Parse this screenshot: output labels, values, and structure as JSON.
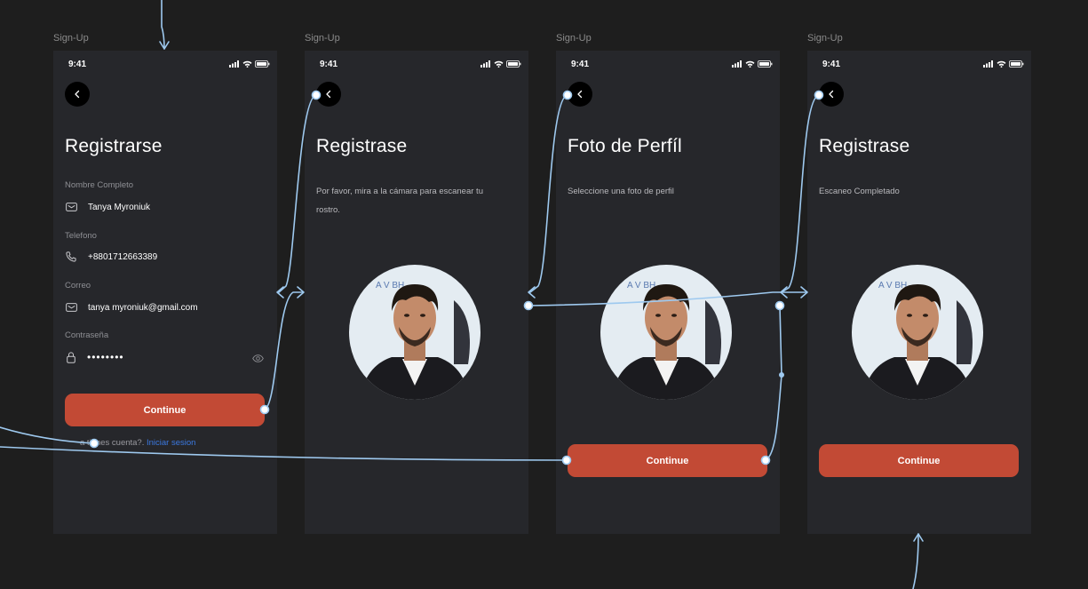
{
  "frames": [
    {
      "label": "Sign-Up",
      "time": "9:41",
      "title": "Registrarse",
      "fields": [
        {
          "label": "Nombre Completo",
          "value": "Tanya Myroniuk",
          "icon": "mail-icon"
        },
        {
          "label": "Telefono",
          "value": "+8801712663389",
          "icon": "phone-icon"
        },
        {
          "label": "Correo",
          "value": "tanya myroniuk@gmail.com",
          "icon": "mail-icon"
        },
        {
          "label": "Contraseña",
          "value": "••••••••",
          "icon": "lock-icon"
        }
      ],
      "button": "Continue",
      "login_prefix": "a tienes cuenta?.",
      "login_link": "Iniciar sesion"
    },
    {
      "label": "Sign-Up",
      "time": "9:41",
      "title": "Registrase",
      "subtitle": "Por favor, mira a la cámara para escanear tu rostro."
    },
    {
      "label": "Sign-Up",
      "time": "9:41",
      "title": "Foto de Perfíl",
      "subtitle": "Seleccione una foto de perfil",
      "button": "Continue"
    },
    {
      "label": "Sign-Up",
      "time": "9:41",
      "title": "Registrase",
      "subtitle": "Escaneo Completado",
      "button": "Continue"
    }
  ],
  "photo_backdrop_text": "A V   BH",
  "colors": {
    "canvas": "#1e1e1e",
    "screen": "#26272b",
    "accent": "#c24a35",
    "connector": "#9ec9ef",
    "link": "#3b78e0"
  }
}
